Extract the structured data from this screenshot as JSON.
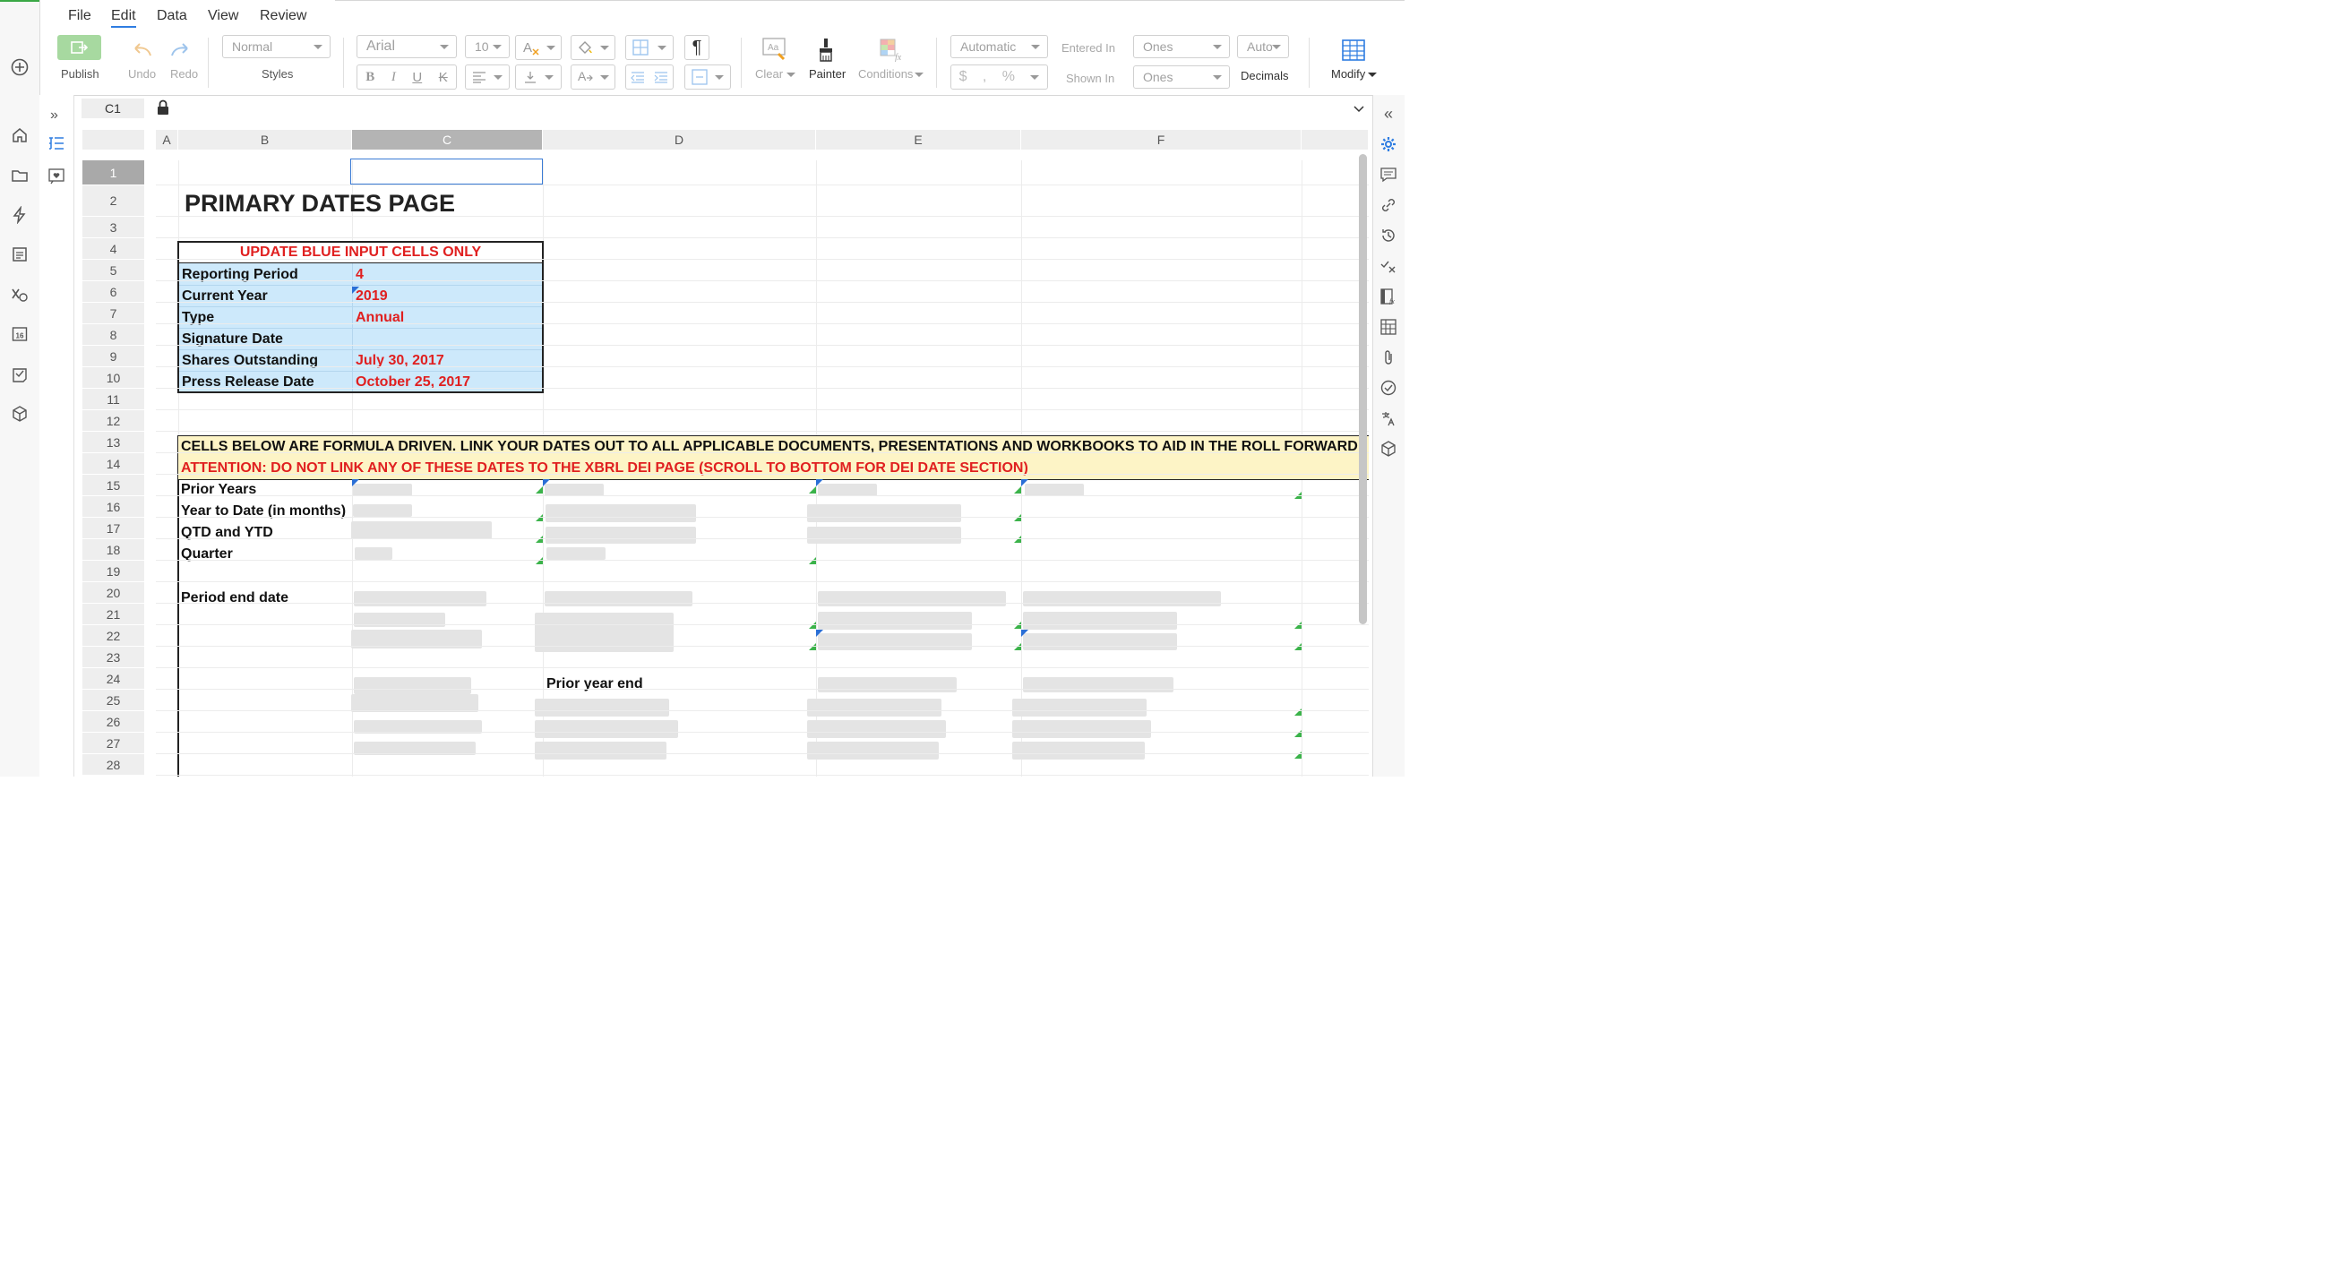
{
  "menu": {
    "items": [
      "File",
      "Edit",
      "Data",
      "View",
      "Review"
    ],
    "active": "Edit"
  },
  "toolbar": {
    "publish": "Publish",
    "undo": "Undo",
    "redo": "Redo",
    "style_value": "Normal",
    "styles_label": "Styles",
    "font_value": "Arial",
    "size_value": "10",
    "clear": "Clear",
    "painter": "Painter",
    "conditions": "Conditions",
    "format_value": "Automatic",
    "entered_in": "Entered In",
    "entered_value": "Ones",
    "shown_in": "Shown In",
    "shown_value": "Ones",
    "decimals_value": "Auto",
    "decimals_label": "Decimals",
    "modify": "Modify",
    "currency": "$",
    "comma": ",",
    "percent": "%"
  },
  "formula_bar": {
    "cell_ref": "C1"
  },
  "columns": [
    "A",
    "B",
    "C",
    "D",
    "E",
    "F"
  ],
  "selected_column": "C",
  "selected_row": "1",
  "rows": [
    "1",
    "2",
    "3",
    "4",
    "5",
    "6",
    "7",
    "8",
    "9",
    "10",
    "11",
    "12",
    "13",
    "14",
    "15",
    "16",
    "17",
    "18",
    "19",
    "20",
    "21",
    "22",
    "23",
    "24",
    "25",
    "26",
    "27",
    "28"
  ],
  "sheet": {
    "title": "PRIMARY DATES PAGE",
    "input_header": "UPDATE BLUE INPUT CELLS ONLY",
    "inputs": [
      {
        "label": "Reporting Period",
        "value": "4"
      },
      {
        "label": "Current Year",
        "value": "2019"
      },
      {
        "label": "Type",
        "value": "Annual"
      },
      {
        "label": "Signature Date",
        "value": ""
      },
      {
        "label": "Shares Outstanding",
        "value": "July 30, 2017"
      },
      {
        "label": "Press Release Date",
        "value": "October 25, 2017"
      }
    ],
    "notice_line1": "CELLS BELOW ARE FORMULA DRIVEN. LINK YOUR DATES OUT TO ALL APPLICABLE DOCUMENTS, PRESENTATIONS AND WORKBOOKS TO AID IN THE ROLL FORWARD",
    "notice_line2": "ATTENTION: DO NOT LINK ANY OF THESE DATES TO THE XBRL DEI PAGE (SCROLL TO BOTTOM FOR DEI DATE SECTION)",
    "labels": {
      "prior_years": "Prior Years",
      "ytd_months": "Year to Date (in months)",
      "qtd_ytd": "QTD and YTD",
      "quarter": "Quarter",
      "period_end": "Period end date",
      "prior_year_end": "Prior year end"
    }
  }
}
